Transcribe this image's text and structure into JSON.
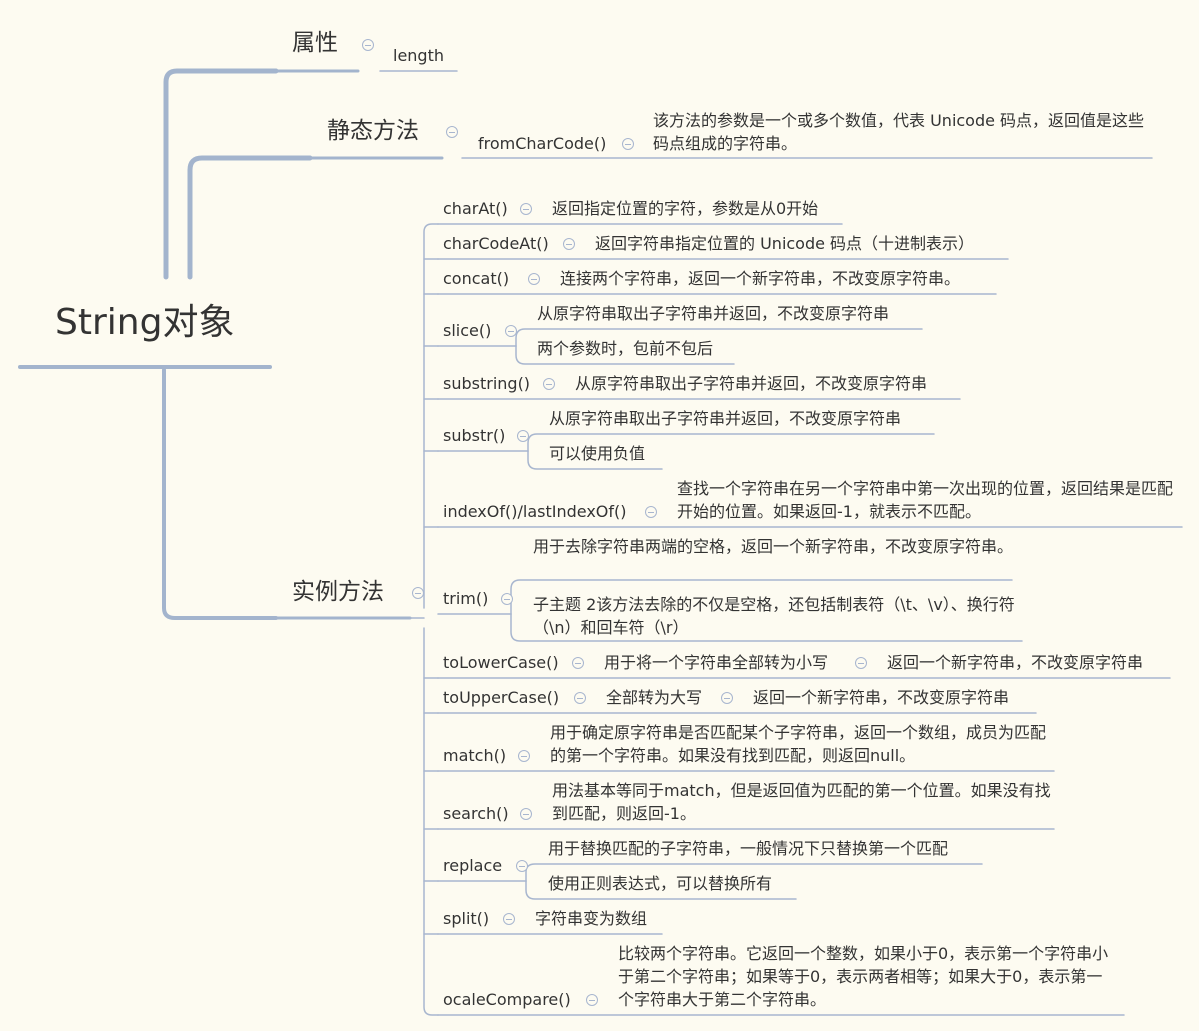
{
  "root": "String对象",
  "properties": {
    "label": "属性",
    "items": [
      "length"
    ]
  },
  "static_methods": {
    "label": "静态方法",
    "items": [
      {
        "name": "fromCharCode()",
        "desc": [
          "该方法的参数是一个或多个数值，代表 Unicode 码点，返回值是这些码点组成的字符串。"
        ]
      }
    ]
  },
  "instance_methods": {
    "label": "实例方法",
    "items": [
      {
        "name": "charAt()",
        "desc": [
          "返回指定位置的字符，参数是从0开始"
        ]
      },
      {
        "name": "charCodeAt()",
        "desc": [
          "返回字符串指定位置的 Unicode 码点（十进制表示）"
        ]
      },
      {
        "name": "concat()",
        "desc": [
          "连接两个字符串，返回一个新字符串，不改变原字符串。"
        ]
      },
      {
        "name": "slice()",
        "desc": [
          "从原字符串取出子字符串并返回，不改变原字符串",
          "两个参数时，包前不包后"
        ]
      },
      {
        "name": "substring()",
        "desc": [
          "从原字符串取出子字符串并返回，不改变原字符串"
        ]
      },
      {
        "name": "substr()",
        "desc": [
          "从原字符串取出子字符串并返回，不改变原字符串",
          "可以使用负值"
        ]
      },
      {
        "name": "indexOf()/lastIndexOf()",
        "desc": [
          "查找一个字符串在另一个字符串中第一次出现的位置，返回结果是匹配开始的位置。如果返回-1，就表示不匹配。"
        ]
      },
      {
        "name": "trim()",
        "desc": [
          "用于去除字符串两端的空格，返回一个新字符串，不改变原字符串。",
          "子主题 2该方法去除的不仅是空格，还包括制表符（\\t、\\v）、换行符（\\n）和回车符（\\r）"
        ]
      },
      {
        "name": "toLowerCase()",
        "desc": [
          "用于将一个字符串全部转为小写"
        ],
        "sub": "返回一个新字符串，不改变原字符串"
      },
      {
        "name": "toUpperCase()",
        "desc": [
          "全部转为大写"
        ],
        "sub": "返回一个新字符串，不改变原字符串"
      },
      {
        "name": "match()",
        "desc": [
          "用于确定原字符串是否匹配某个子字符串，返回一个数组，成员为匹配的第一个字符串。如果没有找到匹配，则返回null。"
        ]
      },
      {
        "name": "search()",
        "desc": [
          "用法基本等同于match，但是返回值为匹配的第一个位置。如果没有找到匹配，则返回-1。"
        ]
      },
      {
        "name": "replace",
        "desc": [
          "用于替换匹配的子字符串，一般情况下只替换第一个匹配",
          "使用正则表达式，可以替换所有"
        ]
      },
      {
        "name": "split()",
        "desc": [
          "字符串变为数组"
        ]
      },
      {
        "name": "ocaleCompare()",
        "desc": [
          "比较两个字符串。它返回一个整数，如果小于0，表示第一个字符串小于第二个字符串；如果等于0，表示两者相等；如果大于0，表示第一个字符串大于第二个字符串。"
        ]
      }
    ]
  },
  "colors": {
    "background": "#fdfbf1",
    "main_line": "#a3b4cd",
    "branch_line": "#a8b6cf",
    "text": "#333333"
  }
}
